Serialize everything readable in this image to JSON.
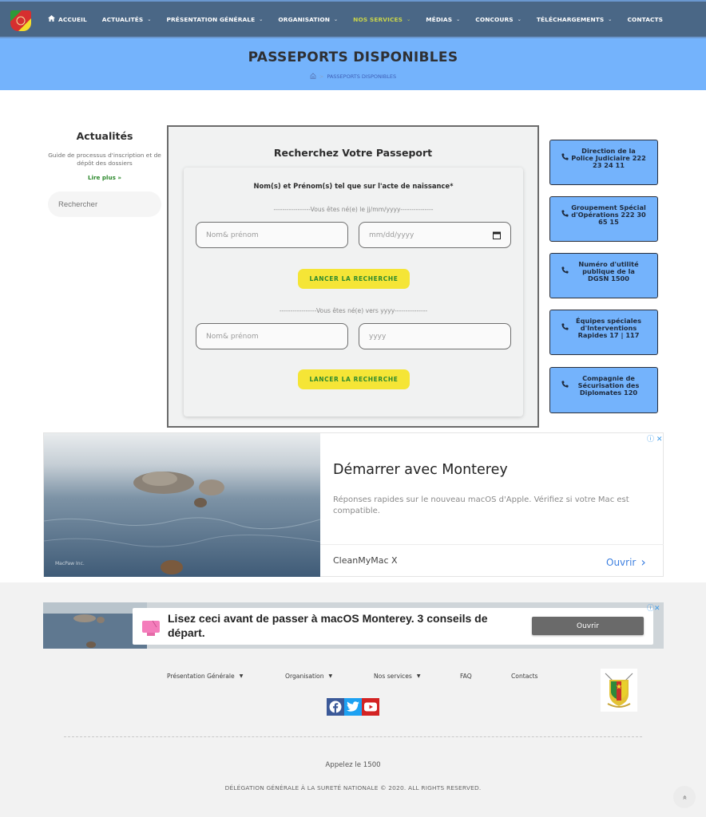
{
  "navbar": {
    "logo_alt": "DGSN logo",
    "items": [
      {
        "label": "ACCUEIL",
        "icon": "home-icon",
        "dropdown": false,
        "active": false
      },
      {
        "label": "ACTUALITÉS",
        "dropdown": true,
        "active": false
      },
      {
        "label": "PRÉSENTATION GÉNÉRALE",
        "dropdown": true,
        "active": false
      },
      {
        "label": "ORGANISATION",
        "dropdown": true,
        "active": false
      },
      {
        "label": "NOS SERVICES",
        "dropdown": true,
        "active": true
      },
      {
        "label": "MÉDIAS",
        "dropdown": true,
        "active": false
      },
      {
        "label": "CONCOURS",
        "dropdown": true,
        "active": false
      },
      {
        "label": "TÉLÉCHARGEMENTS",
        "dropdown": true,
        "active": false
      },
      {
        "label": "CONTACTS",
        "dropdown": false,
        "active": false
      }
    ],
    "chevron": "⌄"
  },
  "hero": {
    "title": "PASSEPORTS DISPONIBLES",
    "breadcrumb": {
      "separator": ">",
      "current": "PASSEPORTS DISPONIBLES"
    }
  },
  "sidebar": {
    "title": "Actualités",
    "news_text": "Guide de processus d'inscription et de dépôt des dossiers",
    "read_more": "Lire plus »",
    "search_placeholder": "Rechercher"
  },
  "form": {
    "title": "Recherchez Votre Passeport",
    "label": "Nom(s) et Prénom(s) tel que sur l'acte de naissance*",
    "section1": {
      "divider": "-----------------Vous êtes né(e) le jj/mm/yyyy---------------",
      "name_placeholder": "Nom& prénom",
      "date_placeholder": "mm/dd/yyyy",
      "button": "LANCER LA RECHERCHE"
    },
    "section2": {
      "divider": "-----------------Vous êtes né(e) vers yyyy---------------",
      "name_placeholder": "Nom& prénom",
      "year_placeholder": "yyyy",
      "button": "LANCER LA RECHERCHE"
    }
  },
  "contacts": [
    {
      "text": "Direction de la Police Judiciaire 222 23 24 11"
    },
    {
      "text": "Groupement Spécial d'Opérations 222 30 65 15"
    },
    {
      "text": "Numéro d'utilité publique de la DGSN 1500"
    },
    {
      "text": "Équipes spéciales d'Interventions Rapides 17 | 117"
    },
    {
      "text": "Compagnie de Sécurisation des Diplomates 120"
    }
  ],
  "ad1": {
    "title": "Démarrer avec Monterey",
    "description": "Réponses rapides sur le nouveau macOS d'Apple. Vérifiez si votre Mac est compatible.",
    "advertiser": "CleanMyMac X",
    "cta": "Ouvrir",
    "cta_arrow": "›",
    "adchoices": "ⓘ ✕",
    "image_caption": "MacPaw Inc."
  },
  "ad2": {
    "text": "Lisez ceci avant de passer à macOS Monterey. 3 conseils de départ.",
    "cta": "Ouvrir",
    "adchoices": "ⓘ✕"
  },
  "footer": {
    "nav": [
      {
        "label": "Présentation Générale",
        "dropdown": true
      },
      {
        "label": "Organisation",
        "dropdown": true
      },
      {
        "label": "Nos services",
        "dropdown": true
      },
      {
        "label": "FAQ",
        "dropdown": false
      },
      {
        "label": "Contacts",
        "dropdown": false
      }
    ],
    "caret": "▼",
    "social": [
      "facebook",
      "twitter",
      "youtube"
    ],
    "call": "Appelez le 1500",
    "copyright": "DÉLÉGATION GÉNÉRALE À LA SURETÉ NATIONALE © 2020. ALL RIGHTS RESERVED.",
    "back_to_top": "«"
  },
  "colors": {
    "nav_bg": "#4a6786",
    "nav_active": "#c9d44a",
    "hero_bg": "#74b3fc",
    "button_bg": "#f5e536",
    "button_text": "#2e8a2e",
    "contact_bg": "#74b3fc",
    "facebook": "#3b5998",
    "twitter": "#1da1f2",
    "youtube": "#d32323"
  }
}
